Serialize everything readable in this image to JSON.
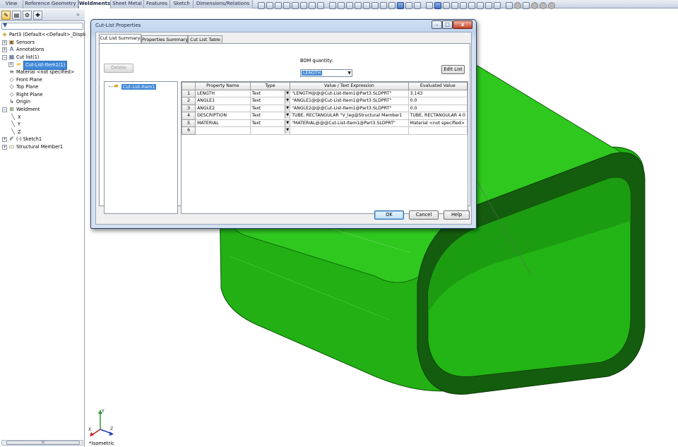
{
  "command_tabs": [
    {
      "label": "View"
    },
    {
      "label": "Reference Geometry"
    },
    {
      "label": "Weldments",
      "active": true
    },
    {
      "label": "Sheet Metal"
    },
    {
      "label": "Features"
    },
    {
      "label": "Sketch"
    },
    {
      "label": "Dimensions/Relations"
    }
  ],
  "feature_tree": {
    "items": [
      {
        "label": "Part3  (Default<<Default>_Display",
        "icon": "part-icon"
      },
      {
        "label": "Sensors",
        "icon": "sensors-icon"
      },
      {
        "label": "Annotations",
        "icon": "annotations-icon"
      },
      {
        "label": "Cut list(1)",
        "icon": "cut-list-icon"
      },
      {
        "label": "Cut-List-Item1(1)",
        "icon": "cut-list-item-folder-icon",
        "selected": true
      },
      {
        "label": "Material <not specified>",
        "icon": "material-icon"
      },
      {
        "label": "Front Plane",
        "icon": "plane-icon"
      },
      {
        "label": "Top Plane",
        "icon": "plane-icon"
      },
      {
        "label": "Right Plane",
        "icon": "plane-icon"
      },
      {
        "label": "Origin",
        "icon": "origin-icon"
      },
      {
        "label": "Weldment",
        "icon": "weldment-icon"
      },
      {
        "label": "X",
        "icon": "axis-icon"
      },
      {
        "label": "Y",
        "icon": "axis-icon"
      },
      {
        "label": "Z",
        "icon": "axis-icon"
      },
      {
        "label": "(-) Sketch1",
        "icon": "sketch-icon"
      },
      {
        "label": "Structural Member1",
        "icon": "structural-member-icon"
      }
    ],
    "hscroll_grip": "III"
  },
  "dialog": {
    "title": "Cut-List Properties",
    "window_buttons": {
      "minimize": "–",
      "maximize": "□",
      "close": "x"
    },
    "tabs": [
      {
        "label": "Cut List Summary",
        "active": true
      },
      {
        "label": "Properties Summary"
      },
      {
        "label": "Cut List Table"
      }
    ],
    "delete_button": "Delete",
    "bom_quantity_label": "BOM quantity:",
    "bom_quantity_value": "LENGTH",
    "edit_list_button": "Edit List",
    "cut_list_item": "Cut-List-Item1",
    "table": {
      "headers": [
        "Property Name",
        "Type",
        "Value / Text Expression",
        "Evaluated Value"
      ],
      "rows": [
        {
          "num": "1",
          "name": "LENGTH",
          "type": "Text",
          "expr": "\"LENGTH@@@Cut-List-Item1@Part3.SLDPRT\"",
          "value": "3.143"
        },
        {
          "num": "2",
          "name": "ANGLE1",
          "type": "Text",
          "expr": "\"ANGLE1@@@Cut-List-Item1@Part3.SLDPRT\"",
          "value": "0.0"
        },
        {
          "num": "3",
          "name": "ANGLE2",
          "type": "Text",
          "expr": "\"ANGLE2@@@Cut-List-Item1@Part3.SLDPRT\"",
          "value": "0.0"
        },
        {
          "num": "4",
          "name": "DESCRIPTION",
          "type": "Text",
          "expr": "TUBE, RECTANGULAR \"V_leg@Structural Member1",
          "value": "TUBE, RECTANGULAR 4.0"
        },
        {
          "num": "5",
          "name": "MATERIAL",
          "type": "Text",
          "expr": "\"MATERIAL@@@Cut-List-Item1@Part3.SLDPRT\"",
          "value": "Material <not specified>"
        },
        {
          "num": "6",
          "name": "",
          "type": "",
          "expr": "",
          "value": ""
        }
      ]
    },
    "ok_button": "OK",
    "cancel_button": "Cancel",
    "help_button": "Help"
  },
  "viewport": {
    "view_label": "*Isometric",
    "triad_axes": [
      "X",
      "Y",
      "Z"
    ],
    "model_color": "#22b014",
    "model_edge_color": "#0e5a08"
  }
}
